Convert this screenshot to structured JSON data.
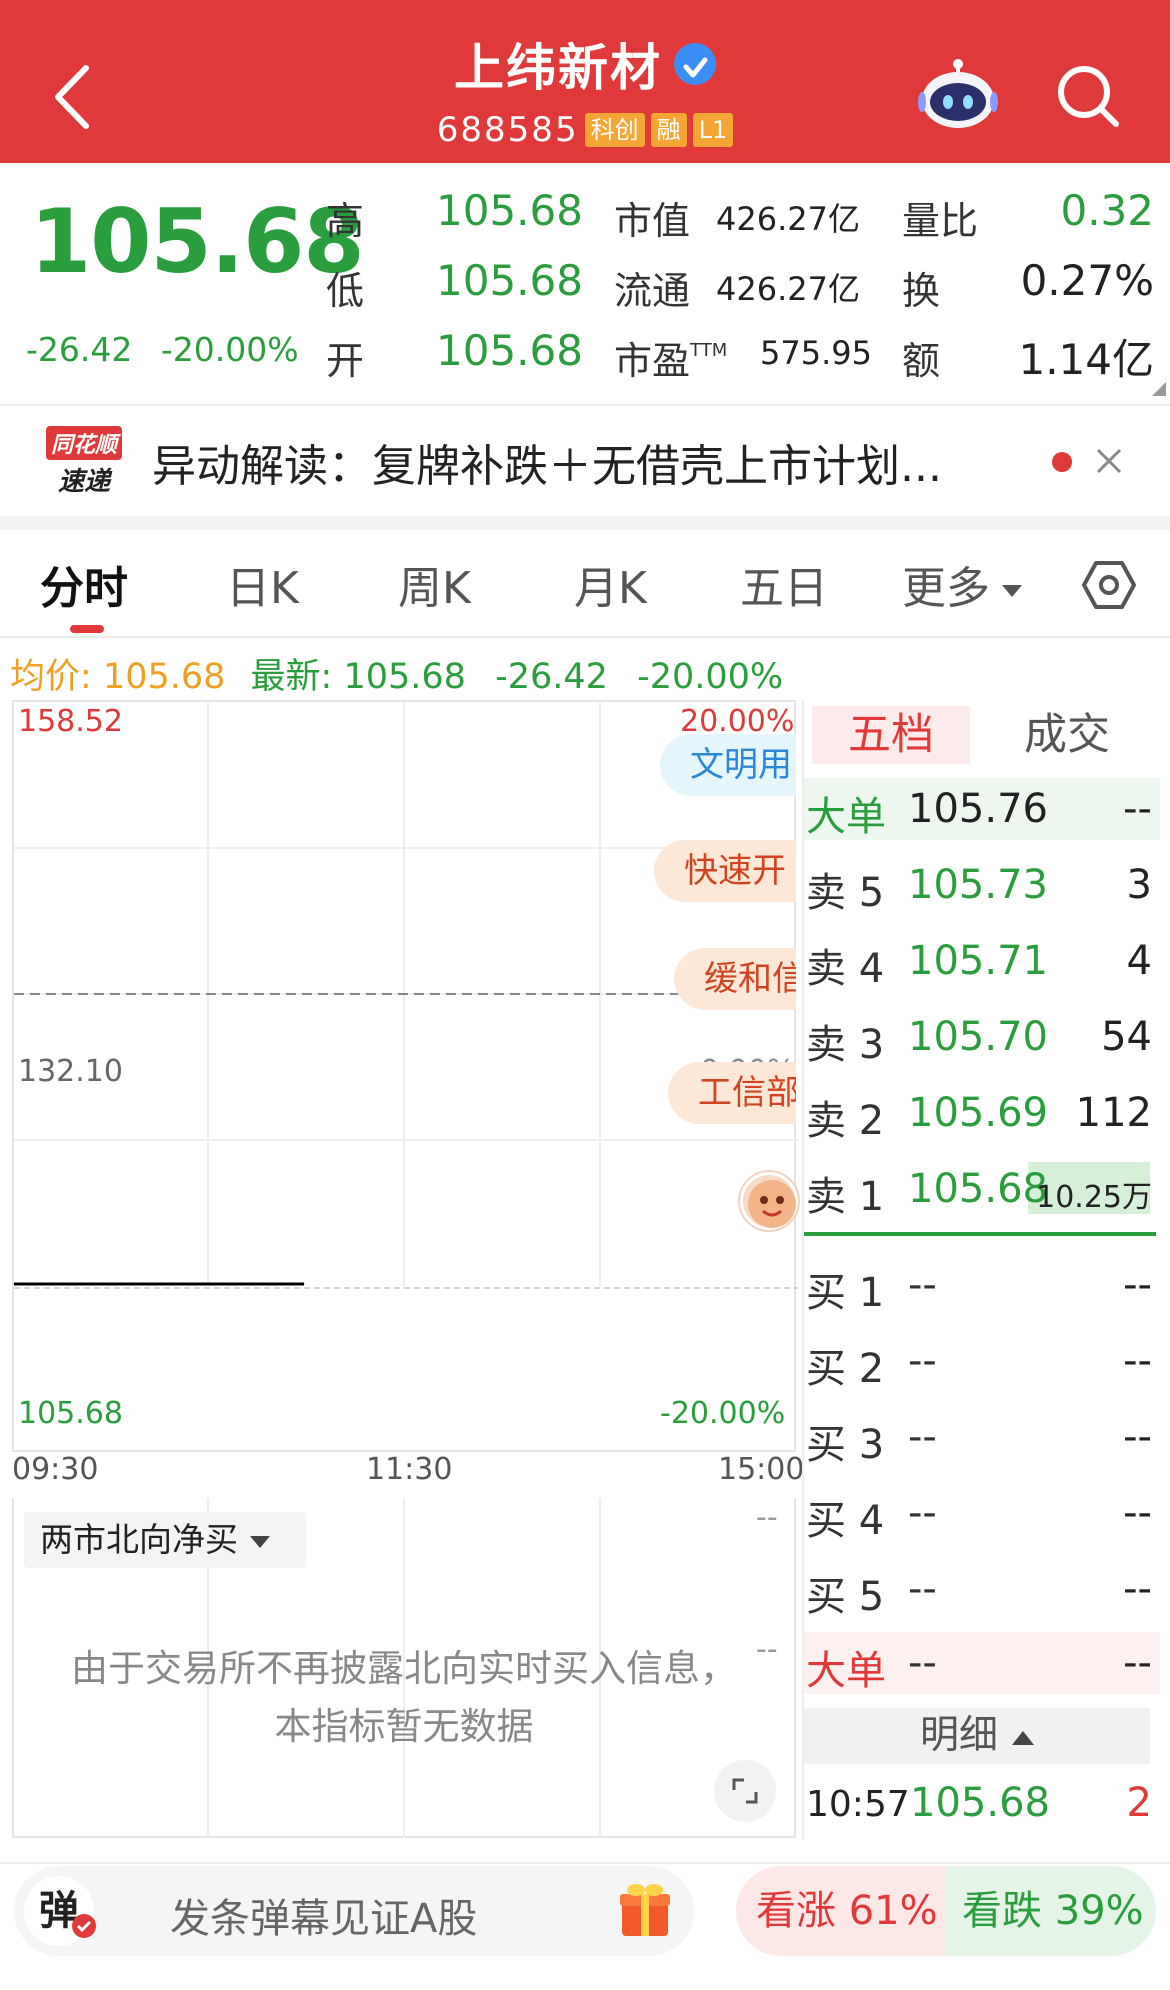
{
  "header": {
    "title": "上纬新材",
    "code": "688585",
    "tags": [
      "科创",
      "融",
      "L1"
    ]
  },
  "quote": {
    "price": "105.68",
    "change": "-26.42",
    "change_pct": "-20.00%",
    "high_label": "高",
    "high": "105.68",
    "low_label": "低",
    "low": "105.68",
    "open_label": "开",
    "open": "105.68",
    "mcap_label": "市值",
    "mcap": "426.27亿",
    "float_label": "流通",
    "float": "426.27亿",
    "pe_label": "市盈",
    "pe_sup": "TTM",
    "pe": "575.95",
    "vol_ratio_label": "量比",
    "vol_ratio": "0.32",
    "turnover_label": "换",
    "turnover": "0.27%",
    "amount_label": "额",
    "amount": "1.14亿"
  },
  "news": {
    "logo_line1": "同花顺",
    "logo_line2": "速递",
    "text": "异动解读：复牌补跌＋无借壳上市计划..."
  },
  "tabs": [
    {
      "label": "分时"
    },
    {
      "label": "日K"
    },
    {
      "label": "周K"
    },
    {
      "label": "月K"
    },
    {
      "label": "五日"
    },
    {
      "label": "更多"
    }
  ],
  "avg_line": {
    "avg_label": "均价:",
    "avg_value": "105.68",
    "latest_label": "最新:",
    "latest_value": "105.68",
    "change": "-26.42",
    "change_pct": "-20.00%"
  },
  "chart_data": {
    "type": "line",
    "y_max_label": "158.52",
    "y_mid_label": "132.10",
    "y_min_label": "105.68",
    "pct_max_label": "20.00%",
    "pct_mid_label": "0.00%",
    "pct_min_label": "-20.00%",
    "x_labels": [
      "09:30",
      "11:30",
      "15:00"
    ],
    "ylim": [
      105.68,
      158.52
    ],
    "x_fraction_range": [
      0,
      1
    ],
    "series": [
      {
        "x_fraction": [
          0.0,
          0.37
        ],
        "values": [
          105.68,
          105.68
        ]
      }
    ],
    "prev_close": 132.1,
    "colors": {
      "up": "#e0393a",
      "down": "#2a9d3d",
      "price_line": "#000000"
    }
  },
  "bubbles": [
    {
      "text": "文明用",
      "style": "blue"
    },
    {
      "text": "快速开",
      "style": "orange"
    },
    {
      "text": "缓和信",
      "style": "orange"
    },
    {
      "text": "工信部",
      "style": "orange"
    }
  ],
  "indicator": {
    "select_label": "两市北向净买",
    "dash1": "--",
    "dash2": "--",
    "no_data_line1": "由于交易所不再披露北向实时买入信息，",
    "no_data_line2": "本指标暂无数据"
  },
  "order_book": {
    "tab_active": "五档",
    "tab_inactive": "成交",
    "rows": [
      {
        "label": "大单",
        "price": "105.76",
        "vol": "--"
      },
      {
        "label": "卖 5",
        "price": "105.73",
        "vol": "3"
      },
      {
        "label": "卖 4",
        "price": "105.71",
        "vol": "4"
      },
      {
        "label": "卖 3",
        "price": "105.70",
        "vol": "54"
      },
      {
        "label": "卖 2",
        "price": "105.69",
        "vol": "112"
      },
      {
        "label": "卖 1",
        "price": "105.68",
        "vol": "10.25万"
      },
      {
        "label": "买 1",
        "price": "--",
        "vol": "--"
      },
      {
        "label": "买 2",
        "price": "--",
        "vol": "--"
      },
      {
        "label": "买 3",
        "price": "--",
        "vol": "--"
      },
      {
        "label": "买 4",
        "price": "--",
        "vol": "--"
      },
      {
        "label": "买 5",
        "price": "--",
        "vol": "--"
      },
      {
        "label": "大单",
        "price": "--",
        "vol": "--"
      }
    ],
    "detail_label": "明细",
    "detail": {
      "time": "10:57",
      "price": "105.68",
      "vol": "2"
    }
  },
  "bottom": {
    "danmu_icon": "弹",
    "danmu_placeholder": "发条弹幕见证A股",
    "bull": "看涨 61%",
    "bear": "看跌 39%",
    "bull_pct": 61,
    "bear_pct": 39
  }
}
